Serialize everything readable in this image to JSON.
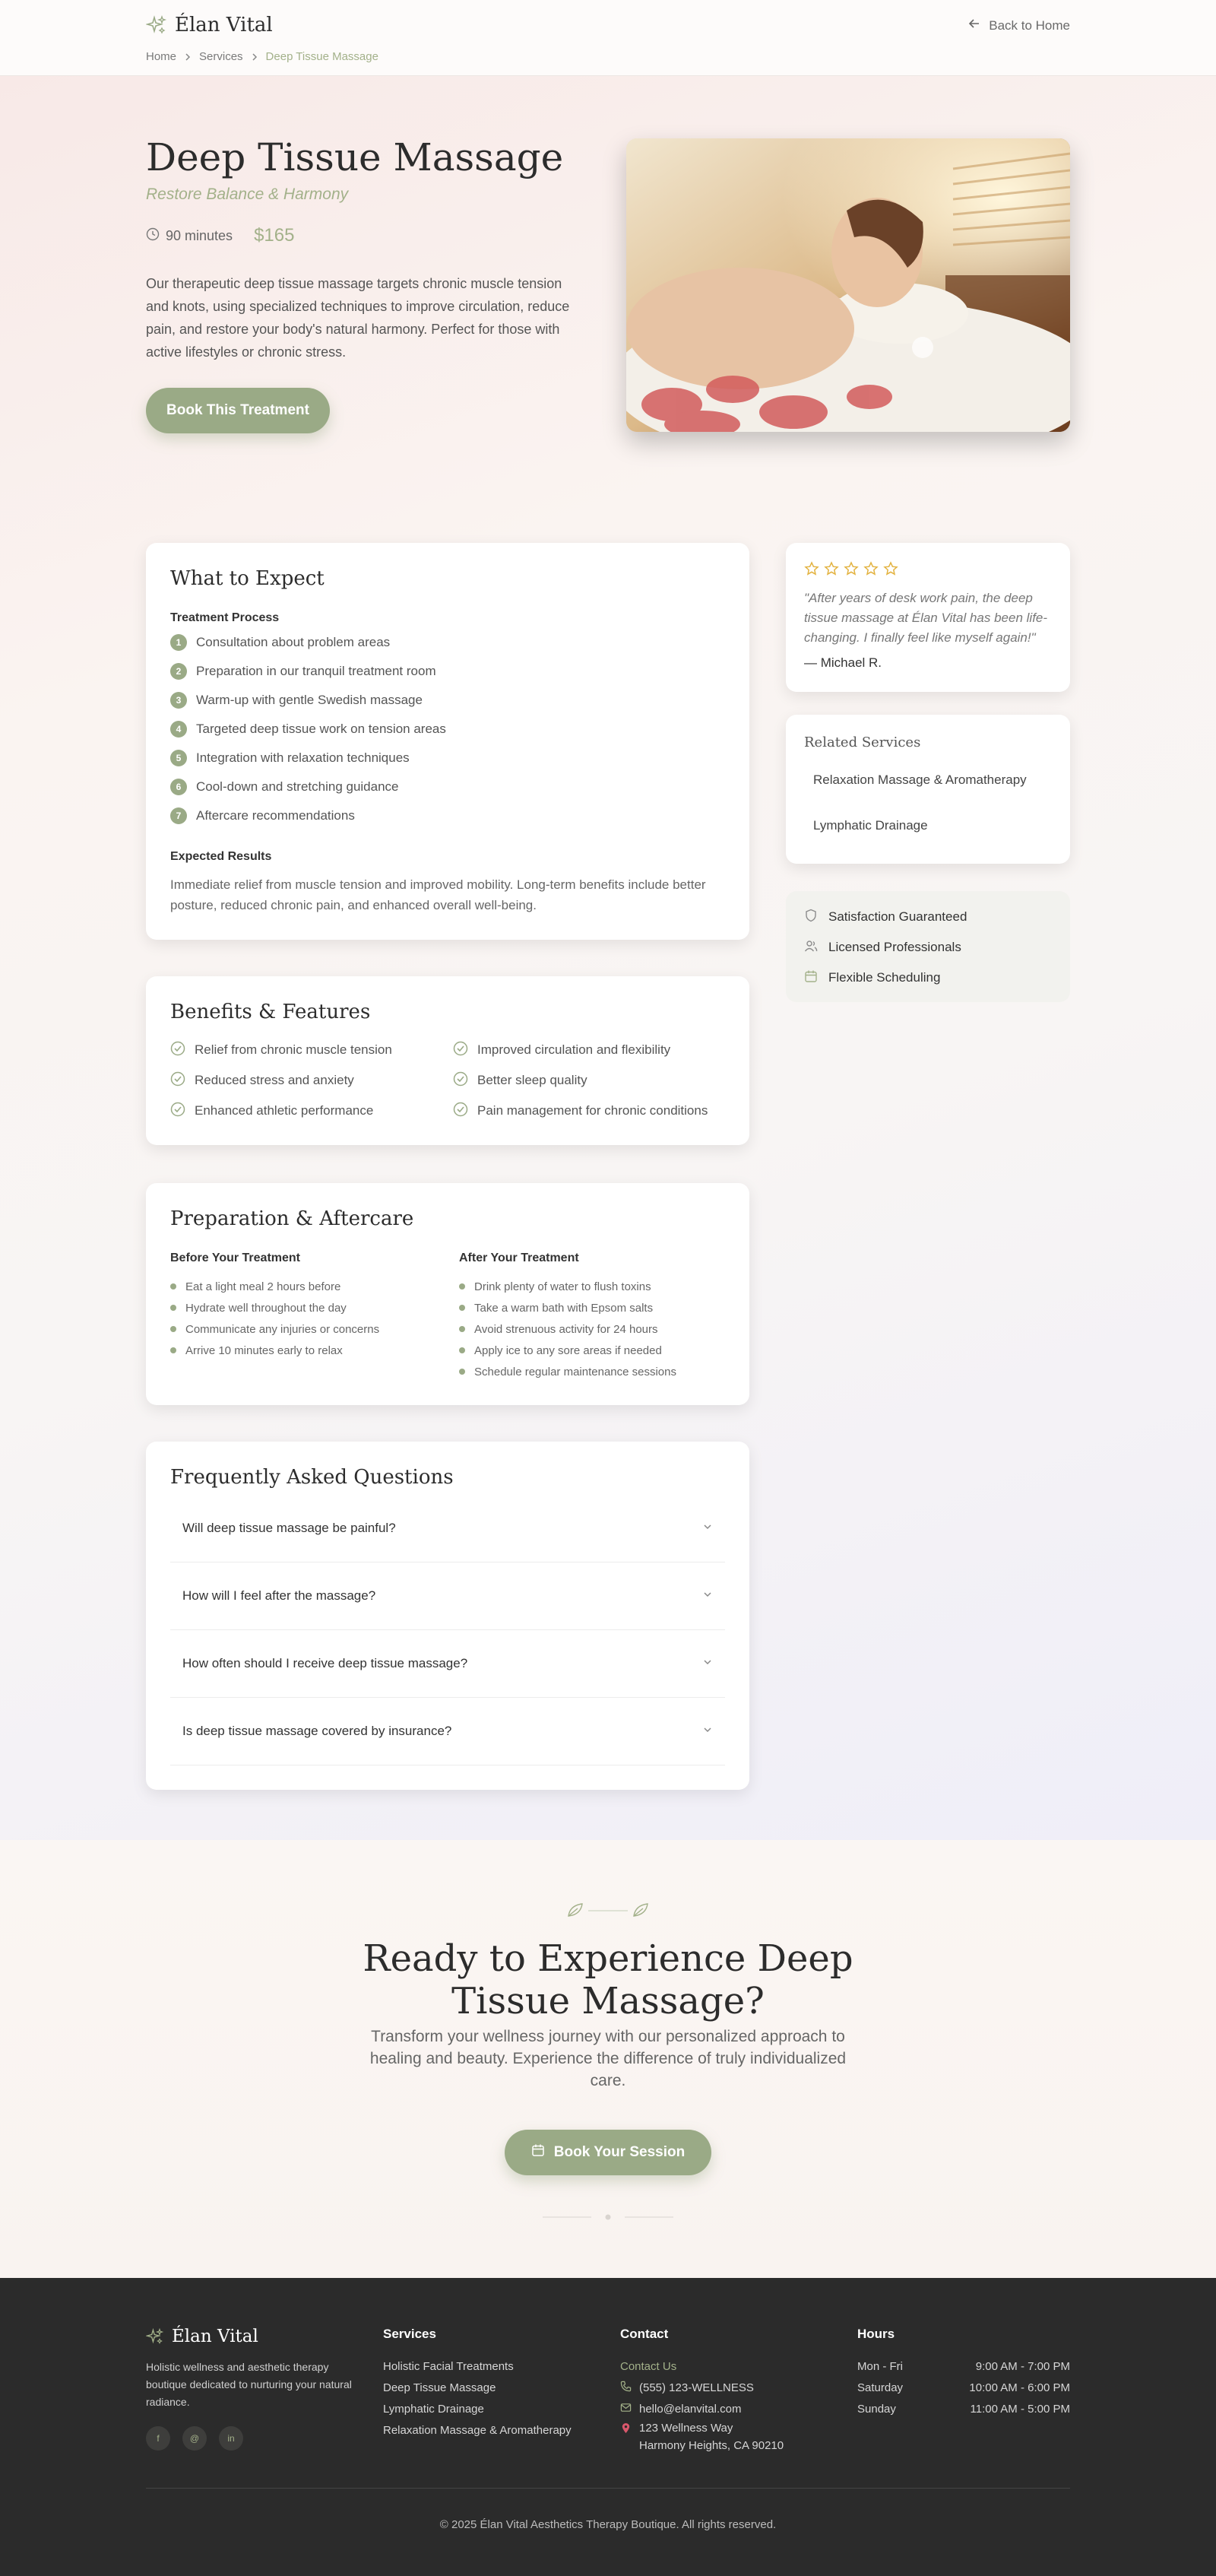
{
  "header": {
    "brand": "Élan Vital",
    "back_label": "Back to Home",
    "breadcrumb": [
      "Home",
      "Services",
      "Deep Tissue Massage"
    ]
  },
  "hero": {
    "title": "Deep Tissue Massage",
    "subtitle": "Restore Balance & Harmony",
    "duration": "90 minutes",
    "price": "$165",
    "description": "Our therapeutic deep tissue massage targets chronic muscle tension and knots, using specialized techniques to improve circulation, reduce pain, and restore your body's natural harmony. Perfect for those with active lifestyles or chronic stress.",
    "book_label": "Book This Treatment"
  },
  "expect": {
    "title": "What to Expect",
    "process_heading": "Treatment Process",
    "steps": [
      {
        "num": "1",
        "text": "Consultation about problem areas"
      },
      {
        "num": "2",
        "text": "Preparation in our tranquil treatment room"
      },
      {
        "num": "3",
        "text": "Warm-up with gentle Swedish massage"
      },
      {
        "num": "4",
        "text": "Targeted deep tissue work on tension areas"
      },
      {
        "num": "5",
        "text": "Integration with relaxation techniques"
      },
      {
        "num": "6",
        "text": "Cool-down and stretching guidance"
      },
      {
        "num": "7",
        "text": "Aftercare recommendations"
      }
    ],
    "results_heading": "Expected Results",
    "results_text": "Immediate relief from muscle tension and improved mobility. Long-term benefits include better posture, reduced chronic pain, and enhanced overall well-being."
  },
  "benefits": {
    "title": "Benefits & Features",
    "items": [
      "Relief from chronic muscle tension",
      "Improved circulation and flexibility",
      "Reduced stress and anxiety",
      "Better sleep quality",
      "Enhanced athletic performance",
      "Pain management for chronic conditions"
    ]
  },
  "prep": {
    "title": "Preparation & Aftercare",
    "before_heading": "Before Your Treatment",
    "before": [
      "Eat a light meal 2 hours before",
      "Hydrate well throughout the day",
      "Communicate any injuries or concerns",
      "Arrive 10 minutes early to relax"
    ],
    "after_heading": "After Your Treatment",
    "after": [
      "Drink plenty of water to flush toxins",
      "Take a warm bath with Epsom salts",
      "Avoid strenuous activity for 24 hours",
      "Apply ice to any sore areas if needed",
      "Schedule regular maintenance sessions"
    ]
  },
  "faq": {
    "title": "Frequently Asked Questions",
    "questions": [
      "Will deep tissue massage be painful?",
      "How will I feel after the massage?",
      "How often should I receive deep tissue massage?",
      "Is deep tissue massage covered by insurance?"
    ]
  },
  "testimonial": {
    "rating": 5,
    "quote": "\"After years of desk work pain, the deep tissue massage at Élan Vital has been life-changing. I finally feel like myself again!\"",
    "author": "— Michael R."
  },
  "related": {
    "title": "Related Services",
    "items": [
      "Relaxation Massage & Aromatherapy",
      "Lymphatic Drainage"
    ]
  },
  "trust": {
    "items": [
      {
        "icon": "shield-icon",
        "text": "Satisfaction Guaranteed"
      },
      {
        "icon": "users-icon",
        "text": "Licensed Professionals"
      },
      {
        "icon": "calendar-icon",
        "text": "Flexible Scheduling"
      }
    ]
  },
  "cta": {
    "title": "Ready to Experience Deep Tissue Massage?",
    "description": "Transform your wellness journey with our personalized approach to healing and beauty. Experience the difference of truly individualized care.",
    "button": "Book Your Session"
  },
  "footer": {
    "brand": "Élan Vital",
    "tagline": "Holistic wellness and aesthetic therapy boutique dedicated to nurturing your natural radiance.",
    "socials": [
      "f",
      "@",
      "in"
    ],
    "services_heading": "Services",
    "services": [
      "Holistic Facial Treatments",
      "Deep Tissue Massage",
      "Lymphatic Drainage",
      "Relaxation Massage & Aromatherapy"
    ],
    "contact_heading": "Contact",
    "contact_link": "Contact Us",
    "phone": "(555) 123-WELLNESS",
    "email": "hello@elanvital.com",
    "address_line1": "123 Wellness Way",
    "address_line2": "Harmony Heights, CA 90210",
    "hours_heading": "Hours",
    "hours": [
      {
        "day": "Mon - Fri",
        "time": "9:00 AM - 7:00 PM"
      },
      {
        "day": "Saturday",
        "time": "10:00 AM - 6:00 PM"
      },
      {
        "day": "Sunday",
        "time": "11:00 AM - 5:00 PM"
      }
    ],
    "copyright": "© 2025 Élan Vital Aesthetics Therapy Boutique. All rights reserved."
  },
  "colors": {
    "accent": "#9aaa86",
    "accent_text": "#a3b18a",
    "star": "#e3b341",
    "footer_bg": "#2b2b2b"
  }
}
